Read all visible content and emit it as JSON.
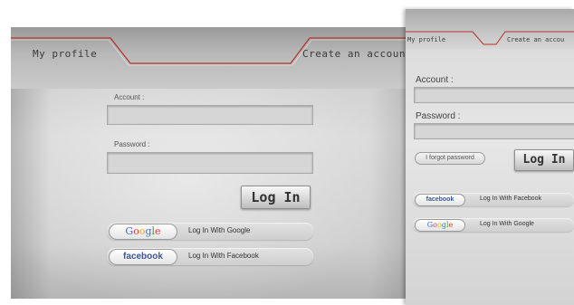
{
  "screen1": {
    "tabs": {
      "my_profile": "My profile",
      "create_account": "Create an account"
    },
    "account_label": "Account :",
    "password_label": "Password :",
    "login_button": "Log In",
    "google_logo": "Google",
    "google_label": "Log In With Google",
    "facebook_logo": "facebook",
    "facebook_label": "Log In With Facebook"
  },
  "screen2": {
    "tabs": {
      "my_profile": "My profile",
      "create_account": "Create an accou"
    },
    "account_label": "Account :",
    "password_label": "Password :",
    "forgot_link": "I forgot password",
    "login_button": "Log In",
    "facebook_logo": "facebook",
    "facebook_label": "Log In With Facebook",
    "google_logo": "Google",
    "google_label": "Log In With Google"
  },
  "colors": {
    "tab_line": "#b8312a",
    "facebook_blue": "#3b5998",
    "google_blue": "#3a6fd8",
    "google_red": "#d6402e",
    "google_yellow": "#e3a91a",
    "google_green": "#3a9a3a"
  }
}
